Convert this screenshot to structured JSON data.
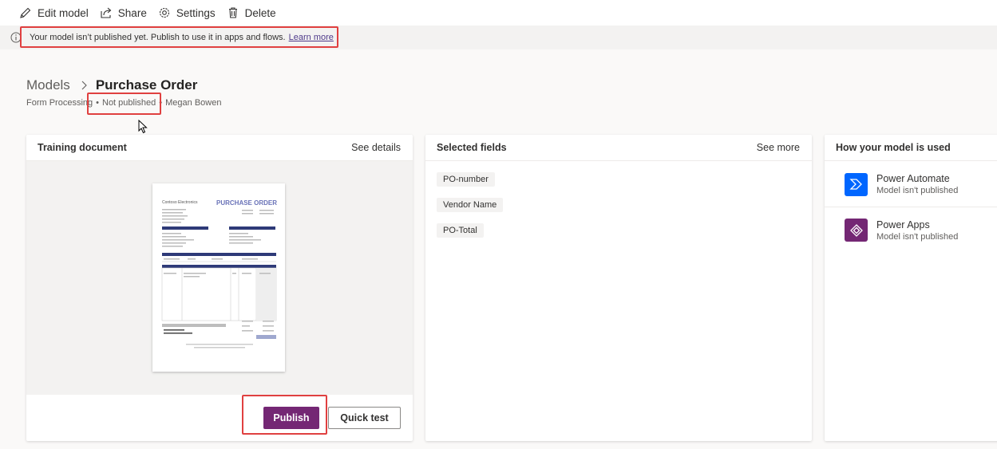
{
  "toolbar": {
    "edit_label": "Edit model",
    "share_label": "Share",
    "settings_label": "Settings",
    "delete_label": "Delete"
  },
  "banner": {
    "message": "Your model isn’t published yet. Publish to use it in apps and flows.",
    "link": "Learn more"
  },
  "breadcrumb": {
    "parent": "Models",
    "current": "Purchase Order"
  },
  "meta": {
    "type": "Form Processing",
    "status": "Not published",
    "owner": "Megan Bowen",
    "separator": "•"
  },
  "training_card": {
    "title": "Training document",
    "link": "See details",
    "doc_company": "Contoso Electronics",
    "doc_title": "PURCHASE ORDER"
  },
  "fields_card": {
    "title": "Selected fields",
    "link": "See more",
    "fields": [
      "PO-number",
      "Vendor Name",
      "PO-Total"
    ]
  },
  "usage_card": {
    "title": "How your model is used",
    "apps": [
      {
        "name": "Power Automate",
        "status": "Model isn't published",
        "color": "#0066ff"
      },
      {
        "name": "Power Apps",
        "status": "Model isn't published",
        "color": "#742774"
      }
    ]
  },
  "actions": {
    "publish_label": "Publish",
    "quick_test_label": "Quick test"
  },
  "colors": {
    "highlight": "#e04040",
    "accent": "#742774"
  }
}
